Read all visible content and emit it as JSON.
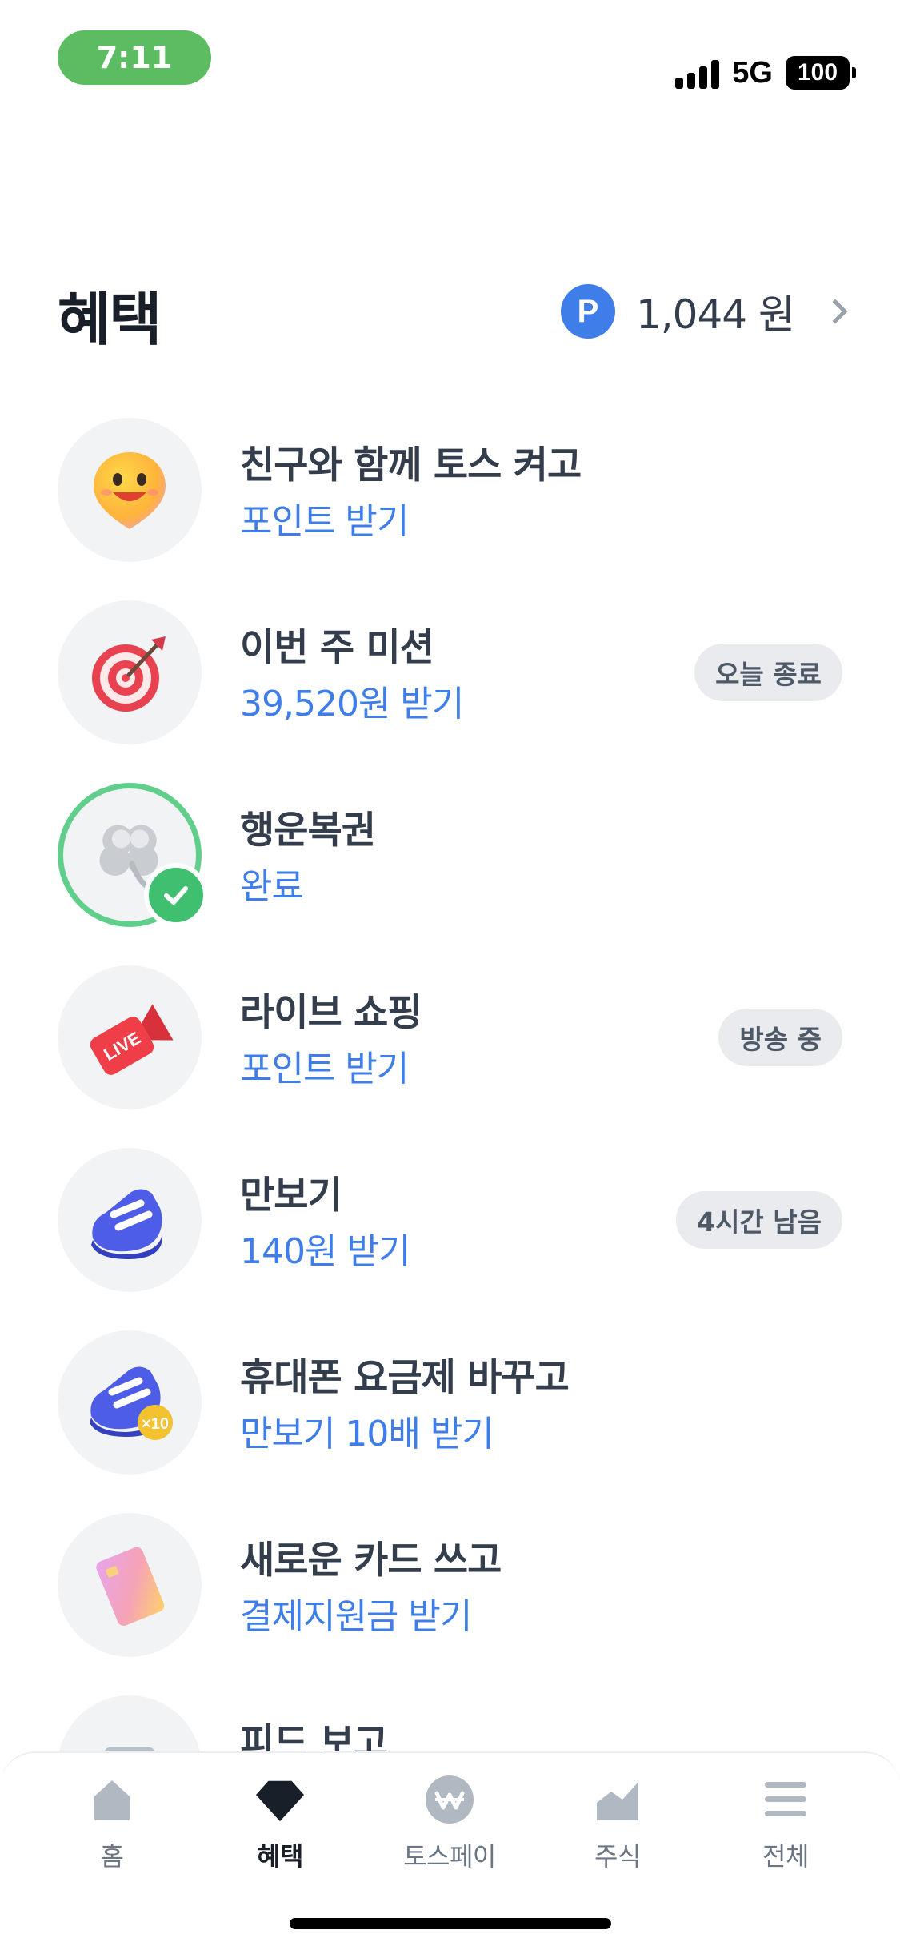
{
  "status_bar": {
    "time": "7:11",
    "network": "5G",
    "battery": "100"
  },
  "header": {
    "title": "혜택",
    "points_badge": "P",
    "points_value": "1,044 원"
  },
  "benefits": [
    {
      "icon": "smiling-pin-icon",
      "title": "친구와 함께 토스 켜고",
      "subtitle": "포인트 받기",
      "badge": ""
    },
    {
      "icon": "target-dart-icon",
      "title": "이번 주 미션",
      "subtitle": "39,520원 받기",
      "badge": "오늘 종료"
    },
    {
      "icon": "clover-icon",
      "title": "행운복권",
      "subtitle": "완료",
      "badge": "",
      "completed": true
    },
    {
      "icon": "live-camera-icon",
      "title": "라이브 쇼핑",
      "subtitle": "포인트 받기",
      "badge": "방송 중"
    },
    {
      "icon": "sneaker-icon",
      "title": "만보기",
      "subtitle": "140원 받기",
      "badge": "4시간 남음"
    },
    {
      "icon": "sneaker-x10-icon",
      "title": "휴대폰 요금제 바꾸고",
      "subtitle": "만보기 10배 받기",
      "badge": "",
      "icon_badge": "×10"
    },
    {
      "icon": "card-icon",
      "title": "새로운 카드 쓰고",
      "subtitle": "결제지원금 받기",
      "badge": ""
    },
    {
      "icon": "feed-icon",
      "title": "피드 보고",
      "subtitle": "",
      "badge": ""
    }
  ],
  "tabs": [
    {
      "icon": "home-icon",
      "label": "홈",
      "active": false
    },
    {
      "icon": "gem-icon",
      "label": "혜택",
      "active": true
    },
    {
      "icon": "toss-pay-icon",
      "label": "토스페이",
      "active": false
    },
    {
      "icon": "stock-chart-icon",
      "label": "주식",
      "active": false
    },
    {
      "icon": "menu-icon",
      "label": "전체",
      "active": false
    }
  ],
  "colors": {
    "accent_blue": "#3f7ee8",
    "status_green": "#5cbc62",
    "done_green": "#3fbf6f"
  }
}
